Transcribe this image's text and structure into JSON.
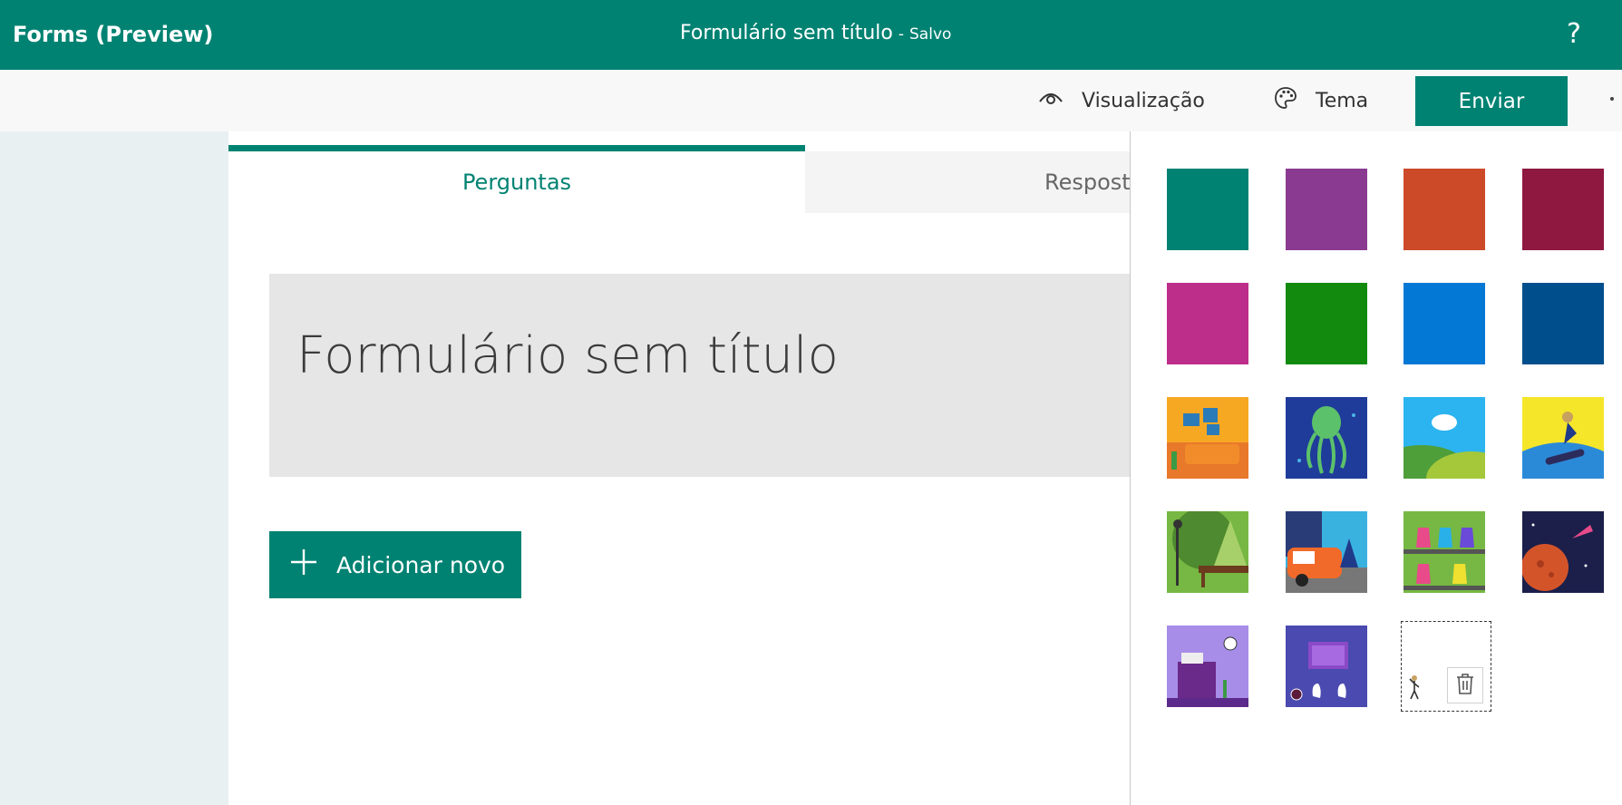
{
  "header": {
    "app_name": "Forms (Preview)",
    "form_title": "Formulário sem título",
    "separator": "-",
    "save_status": "Salvo",
    "help_label": "?"
  },
  "toolbar": {
    "preview_label": "Visualização",
    "theme_label": "Tema",
    "send_label": "Enviar"
  },
  "tabs": [
    {
      "label": "Perguntas",
      "active": true
    },
    {
      "label": "Respostas",
      "active": false
    }
  ],
  "form": {
    "title": "Formulário sem título",
    "add_new_label": "Adicionar novo"
  },
  "theme_panel": {
    "swatches": [
      {
        "kind": "color",
        "color": "#008272"
      },
      {
        "kind": "color",
        "color": "#8b3a91"
      },
      {
        "kind": "color",
        "color": "#cc4a28"
      },
      {
        "kind": "color",
        "color": "#8e1840"
      },
      {
        "kind": "color",
        "color": "#bd2d8a"
      },
      {
        "kind": "color",
        "color": "#118a0e"
      },
      {
        "kind": "color",
        "color": "#0378d4"
      },
      {
        "kind": "color",
        "color": "#004e8c"
      },
      {
        "kind": "image",
        "icon": "living-room-image"
      },
      {
        "kind": "image",
        "icon": "octopus-image"
      },
      {
        "kind": "image",
        "icon": "hills-sky-image"
      },
      {
        "kind": "image",
        "icon": "snowboarder-image"
      },
      {
        "kind": "image",
        "icon": "park-bench-image"
      },
      {
        "kind": "image",
        "icon": "van-city-image"
      },
      {
        "kind": "image",
        "icon": "lab-flasks-image"
      },
      {
        "kind": "image",
        "icon": "space-planet-image"
      },
      {
        "kind": "image",
        "icon": "desk-typewriter-image"
      },
      {
        "kind": "image",
        "icon": "keyboard-hands-image"
      }
    ],
    "custom_slot_icon": "trash-icon"
  },
  "colors": {
    "brand": "#008272",
    "toolbar_bg": "#f8f8f8",
    "page_bg": "#e8f0f2"
  }
}
